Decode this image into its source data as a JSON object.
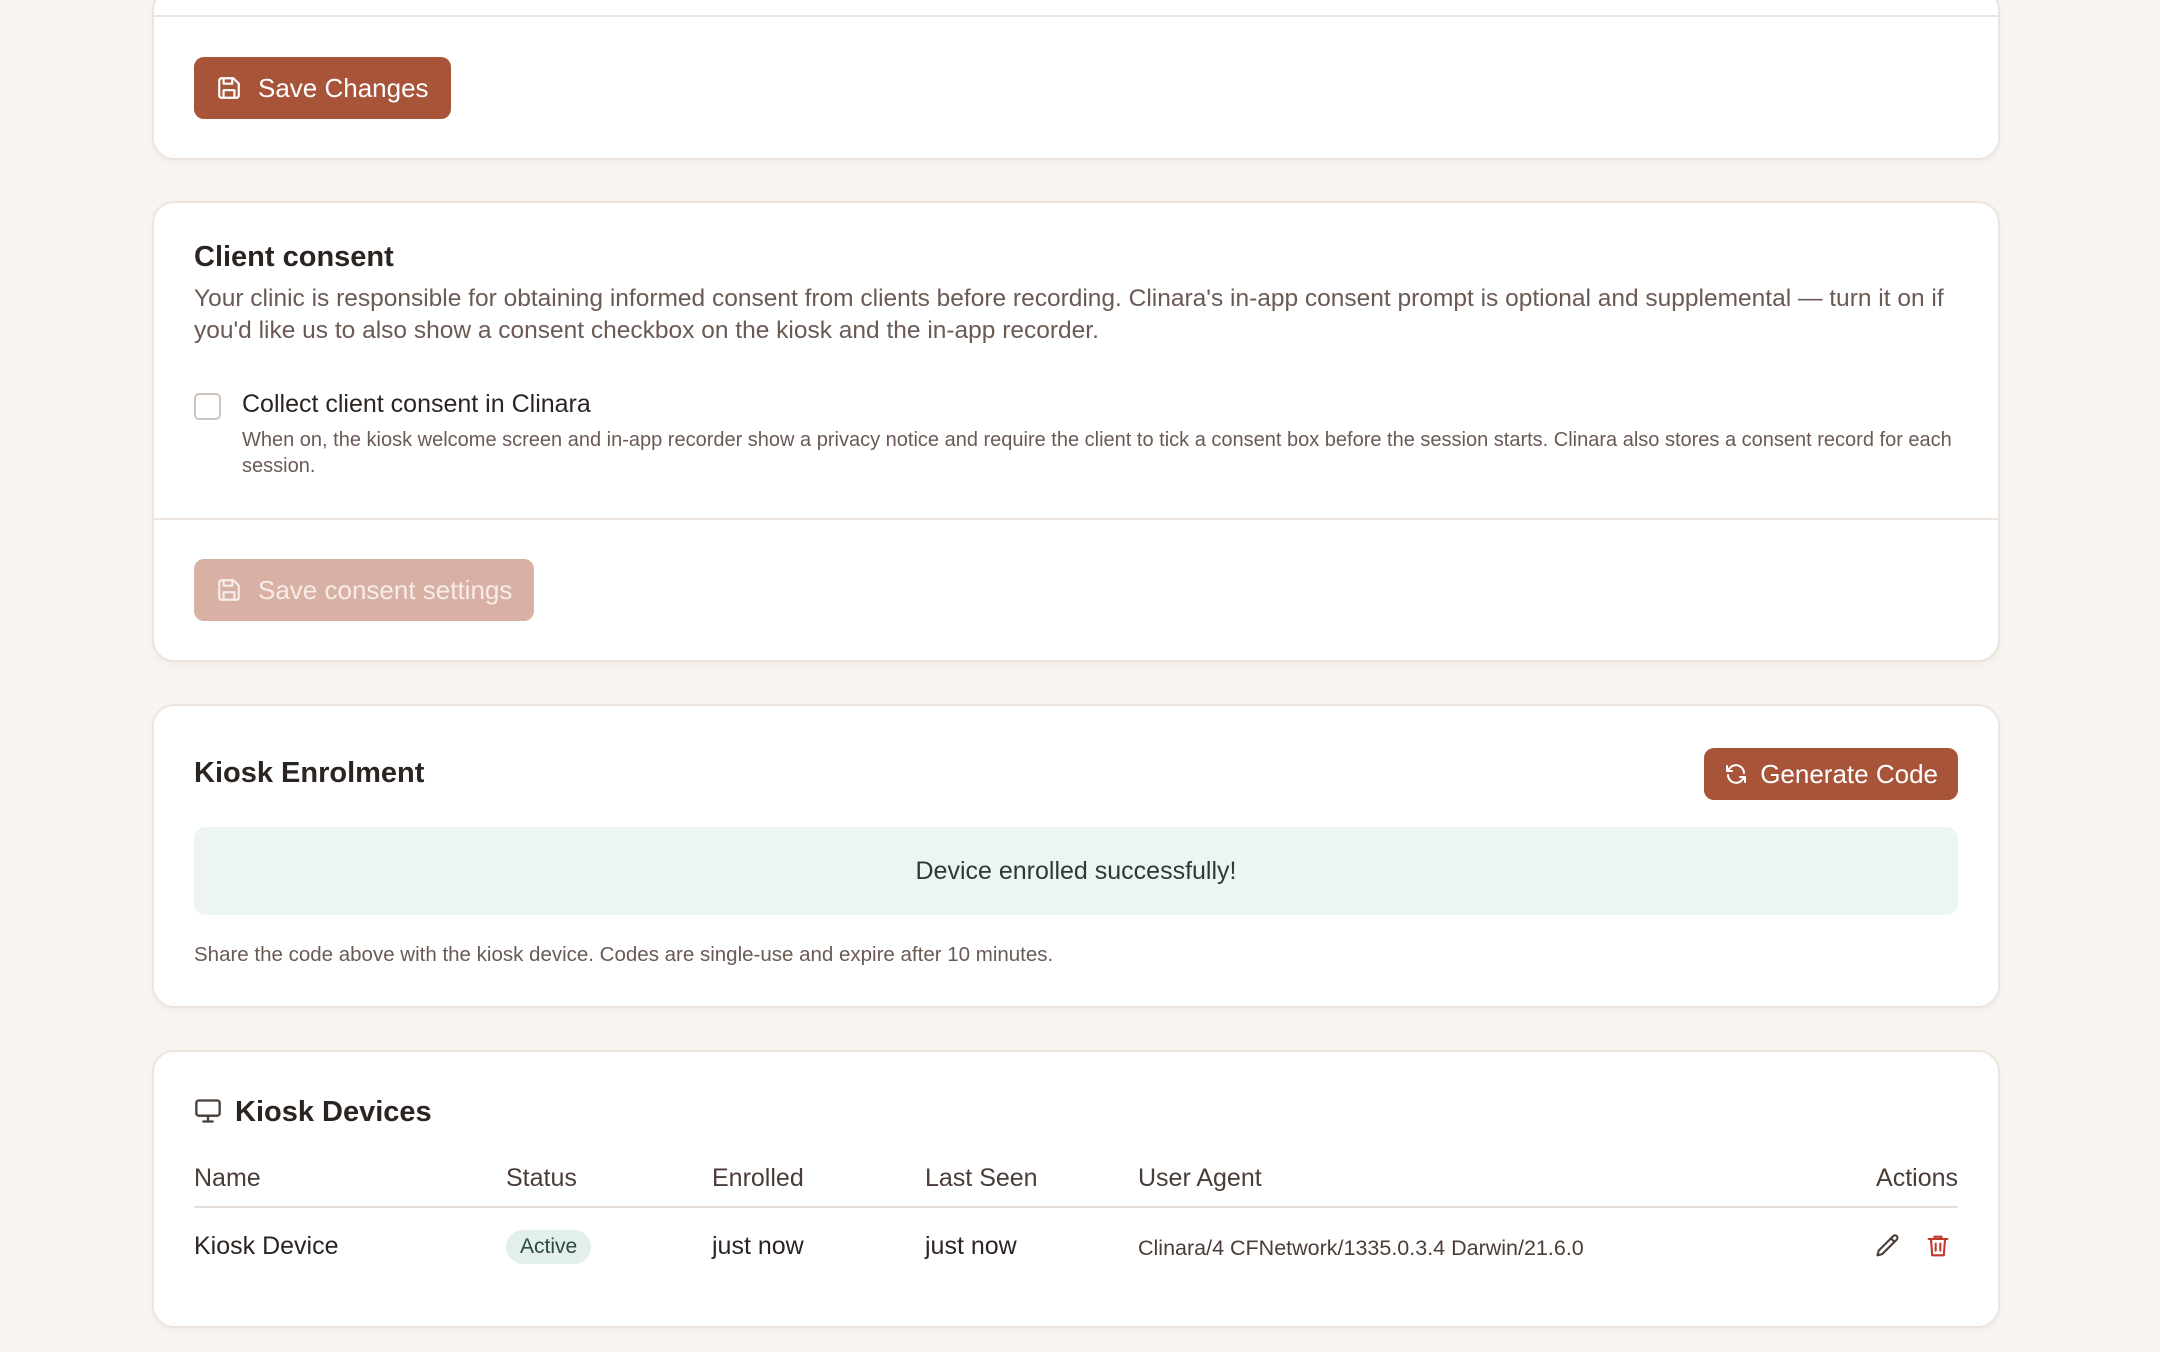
{
  "save_card": {
    "save_button_label": "Save Changes"
  },
  "consent": {
    "title": "Client consent",
    "description": "Your clinic is responsible for obtaining informed consent from clients before recording. Clinara's in-app consent prompt is optional and supplemental — turn it on if you'd like us to also show a consent checkbox on the kiosk and the in-app recorder.",
    "checkbox_label": "Collect client consent in Clinara",
    "checkbox_checked": false,
    "checkbox_help": "When on, the kiosk welcome screen and in-app recorder show a privacy notice and require the client to tick a consent box before the session starts. Clinara also stores a consent record for each session.",
    "save_button_label": "Save consent settings"
  },
  "enrolment": {
    "title": "Kiosk Enrolment",
    "generate_button_label": "Generate Code",
    "success_message": "Device enrolled successfully!",
    "help_text": "Share the code above with the kiosk device. Codes are single-use and expire after 10 minutes."
  },
  "devices": {
    "title": "Kiosk Devices",
    "columns": {
      "name": "Name",
      "status": "Status",
      "enrolled": "Enrolled",
      "last_seen": "Last Seen",
      "user_agent": "User Agent",
      "actions": "Actions"
    },
    "rows": [
      {
        "name": "Kiosk Device",
        "status": "Active",
        "enrolled": "just now",
        "last_seen": "just now",
        "user_agent": "Clinara/4 CFNetwork/1335.0.3.4 Darwin/21.6.0"
      }
    ]
  },
  "colors": {
    "accent": "#a85439",
    "accent_disabled": "#d8b1a4",
    "success_bg": "#edf5f3",
    "page_bg": "#f8f5f1",
    "delete": "#c0392b"
  },
  "icons": {
    "save": "floppy-disk-icon",
    "generate": "refresh-icon",
    "devices": "monitor-icon",
    "edit": "pencil-icon",
    "delete": "trash-icon"
  }
}
